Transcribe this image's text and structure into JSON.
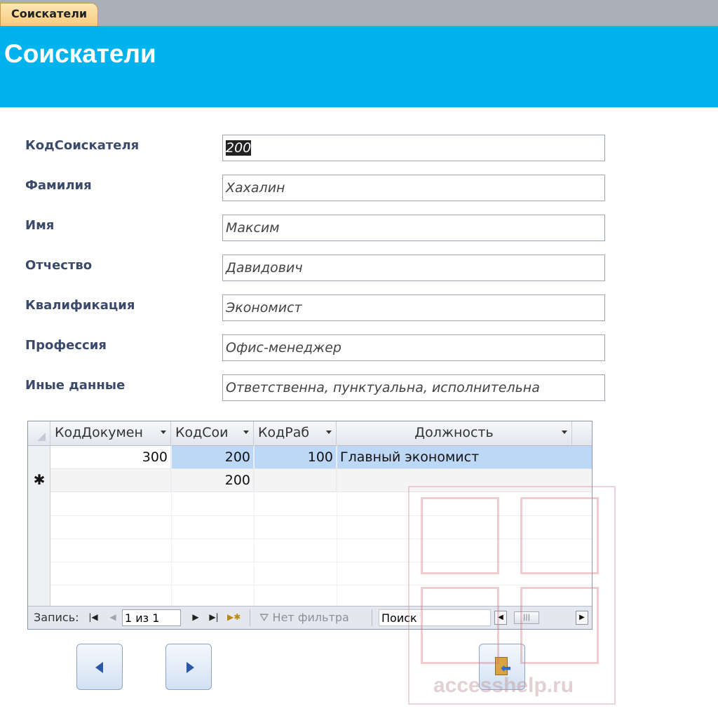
{
  "tab": {
    "label": "Соискатели"
  },
  "header": {
    "title": "Соискатели"
  },
  "form": {
    "fields": [
      {
        "label": "КодСоискателя",
        "value": "200"
      },
      {
        "label": "Фамилия",
        "value": "Хахалин"
      },
      {
        "label": "Имя",
        "value": "Максим"
      },
      {
        "label": "Отчество",
        "value": "Давидович"
      },
      {
        "label": "Квалификация",
        "value": "Экономист"
      },
      {
        "label": "Профессия",
        "value": "Офис-менеджер"
      },
      {
        "label": "Иные данные",
        "value": "Ответственна, пунктуальна, исполнительна"
      }
    ]
  },
  "subform": {
    "columns": [
      "КодДокумен",
      "КодСои",
      "КодРаб",
      "Должность"
    ],
    "rows": [
      [
        "300",
        "200",
        "100",
        "Главный экономист"
      ]
    ],
    "new_row": {
      "marker": "✱",
      "default_value": "200"
    }
  },
  "navbar": {
    "record_label": "Запись:",
    "record_value": "1 из 1",
    "filter_label": "Нет фильтра",
    "search_placeholder": "Поиск",
    "first_icon": "first-record-icon",
    "prev_icon": "prev-record-icon",
    "next_icon": "next-record-icon",
    "last_icon": "last-record-icon",
    "new_icon": "new-record-icon"
  },
  "buttons": {
    "prev_icon": "triangle-left-icon",
    "next_icon": "triangle-right-icon",
    "exit_icon": "exit-door-icon"
  },
  "watermark": {
    "text": "accesshelp.ru"
  },
  "colors": {
    "header": "#00b3ec",
    "tab": "#f7c97b",
    "label": "#3b4a6a",
    "selected_cell": "#bcd8f6"
  }
}
